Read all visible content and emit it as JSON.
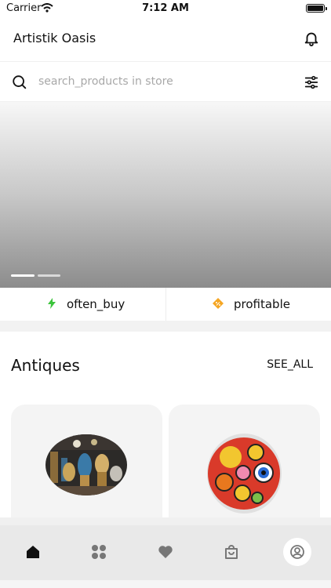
{
  "status_bar": {
    "carrier": "Carrier",
    "time": "7:12 AM"
  },
  "header": {
    "title": "Artistik Oasis",
    "bell_icon": "bell-icon"
  },
  "search": {
    "placeholder": "search_products in store",
    "search_icon": "search-icon",
    "filter_icon": "filter-sliders-icon"
  },
  "banner": {
    "slides_total": 2,
    "active_slide": 1
  },
  "quick_links": [
    {
      "label": "often_buy",
      "icon": "lightning-icon",
      "color": "#3cc43c"
    },
    {
      "label": "profitable",
      "icon": "discount-tag-icon",
      "color": "#f5a623"
    }
  ],
  "section": {
    "title": "Antiques",
    "see_all": "SEE_ALL"
  },
  "tab_bar": {
    "tabs": [
      {
        "name": "home",
        "icon": "home-icon",
        "active": true
      },
      {
        "name": "categories",
        "icon": "grid-icon",
        "active": false
      },
      {
        "name": "favorites",
        "icon": "heart-icon",
        "active": false
      },
      {
        "name": "cart",
        "icon": "bag-icon",
        "active": false
      },
      {
        "name": "profile",
        "icon": "profile-icon",
        "active": false
      }
    ]
  },
  "colors": {
    "accent": "#111111",
    "muted": "#a8a8a8",
    "card_bg": "#f4f4f4"
  }
}
